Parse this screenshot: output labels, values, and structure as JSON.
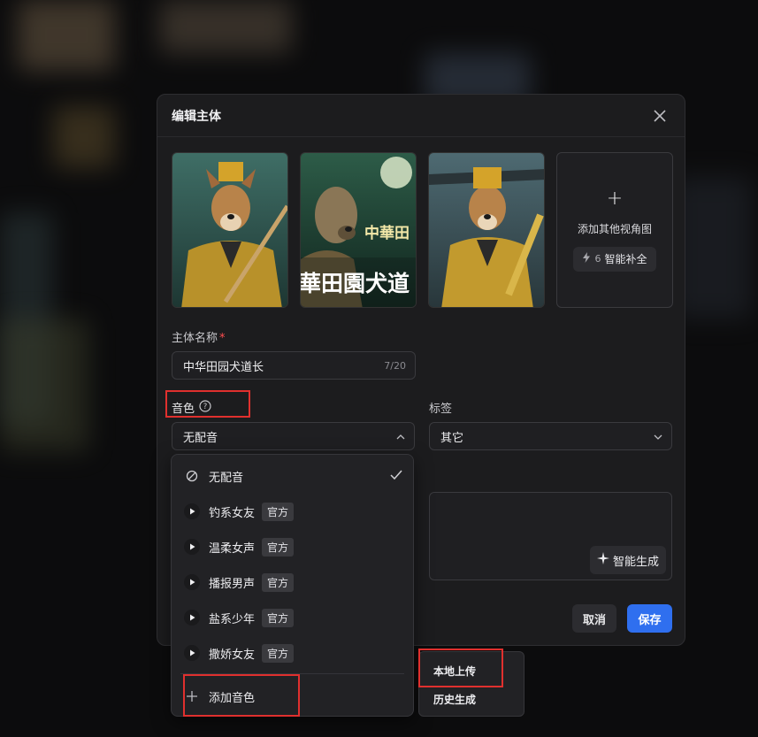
{
  "modal": {
    "title": "编辑主体",
    "add_view_label": "添加其他视角图",
    "smart_fill": {
      "cost": "6",
      "label": "智能补全"
    }
  },
  "thumbnails": [
    {
      "name": "dog-priest-image-1"
    },
    {
      "name": "dog-priest-image-2",
      "overlay_text_top": "中華田",
      "overlay_text_bottom": "華田園犬道"
    },
    {
      "name": "dog-priest-image-3"
    }
  ],
  "form": {
    "name_label": "主体名称",
    "name_required": "*",
    "name_value": "中华田园犬道长",
    "name_count": "7/20",
    "voice_label": "音色",
    "voice_value": "无配音",
    "tag_label": "标签",
    "tag_value": "其它",
    "generate_label": "智能生成"
  },
  "footer": {
    "cancel": "取消",
    "save": "保存"
  },
  "voice_dropdown": {
    "items": [
      {
        "label": "无配音",
        "badge": "",
        "selected": true
      },
      {
        "label": "钓系女友",
        "badge": "官方"
      },
      {
        "label": "温柔女声",
        "badge": "官方"
      },
      {
        "label": "播报男声",
        "badge": "官方"
      },
      {
        "label": "盐系少年",
        "badge": "官方"
      },
      {
        "label": "撒娇女友",
        "badge": "官方"
      }
    ],
    "add_voice": "添加音色"
  },
  "add_voice_submenu": {
    "items": [
      "本地上传",
      "历史生成"
    ]
  },
  "colors": {
    "accent": "#2f6fef",
    "highlight_box": "#e0302e"
  }
}
